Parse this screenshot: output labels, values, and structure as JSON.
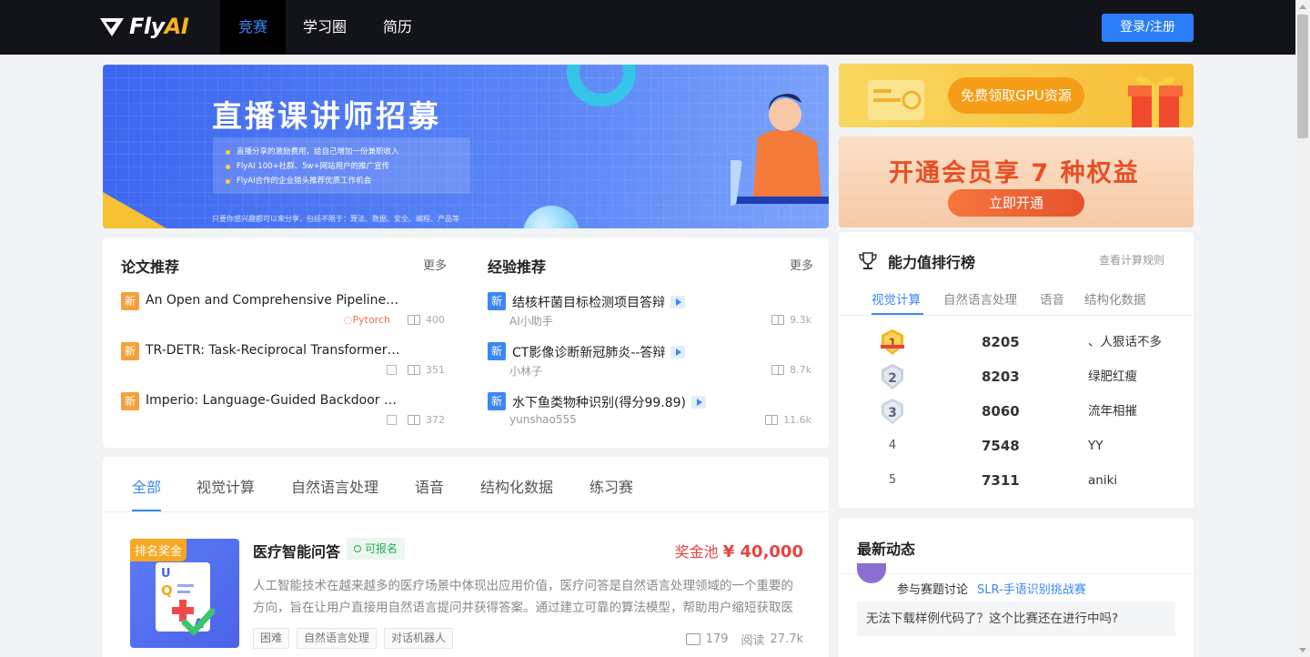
{
  "nav": {
    "logo_fly": "Fly",
    "logo_ai": "AI",
    "items": [
      "竞赛",
      "学习圈",
      "简历"
    ],
    "login": "登录/注册"
  },
  "banner": {
    "title": "直播课讲师招募",
    "points": [
      "直播分享的激励费用，给自己增加一份兼职收入",
      "FlyAI 100+社群、5w+网站用户的推广宣传",
      "FlyAI合作的企业猎头推荐优质工作机会"
    ],
    "footer": "只要你感兴趣都可以来分享，包括不限于：算法、数据、安全、编程、产品等"
  },
  "promo": {
    "gpu": "免费领取GPU资源",
    "vip_title": "开通会员享 7 种权益",
    "vip_button": "立即开通"
  },
  "papers": {
    "title": "论文推荐",
    "more": "更多",
    "badge": "新",
    "items": [
      {
        "text": "An Open and Comprehensive Pipeline for Unified Object Grounding",
        "tag": "Pytorch",
        "count": "400"
      },
      {
        "text": "TR-DETR: Task-Reciprocal Transformer for Joint Moment Retrieval",
        "tag": "",
        "count": "351"
      },
      {
        "text": "Imperio: Language-Guided Backdoor Attacks for Arbitrary Model Control",
        "tag": "",
        "count": "372"
      }
    ]
  },
  "experience": {
    "title": "经验推荐",
    "more": "更多",
    "badge": "新",
    "items": [
      {
        "text": "结核杆菌目标检测项目答辩",
        "author": "AI小助手",
        "count": "9.3k"
      },
      {
        "text": "CT影像诊断新冠肺炎--答辩",
        "author": "小林子",
        "count": "8.7k"
      },
      {
        "text": "水下鱼类物种识别(得分99.89)",
        "author": "yunshao555",
        "count": "11.6k"
      }
    ]
  },
  "competition": {
    "tabs": [
      "全部",
      "视觉计算",
      "自然语言处理",
      "语音",
      "结构化数据",
      "练习赛"
    ],
    "card": {
      "badge": "排名奖金",
      "name": "医疗智能问答",
      "status": "可报名",
      "prize_label": "奖金池",
      "prize_value": "¥ 40,000",
      "desc": "人工智能技术在越来越多的医疗场景中体现出应用价值，医疗问答是自然语言处理领域的一个重要的方向，旨在让用户直接用自然语言提问并获得答案。通过建立可靠的算法模型，帮助用户缩短获取医疗信息的时间。",
      "tags": [
        "困难",
        "自然语言处理",
        "对话机器人"
      ],
      "comments": "179",
      "reads_label": "阅读",
      "reads": "27.7k"
    }
  },
  "ranking": {
    "title": "能力值排行榜",
    "rule": "查看计算规则",
    "tabs": [
      "视觉计算",
      "自然语言处理",
      "语音",
      "结构化数据"
    ],
    "rows": [
      {
        "rank": "1",
        "score": "8205",
        "user": "、人狠话不多"
      },
      {
        "rank": "2",
        "score": "8203",
        "user": "绿肥红瘦"
      },
      {
        "rank": "3",
        "score": "8060",
        "user": "流年相摧"
      },
      {
        "rank": "4",
        "score": "7548",
        "user": "YY"
      },
      {
        "rank": "5",
        "score": "7311",
        "user": "aniki"
      }
    ]
  },
  "news": {
    "title": "最新动态",
    "action": "参与赛题讨论",
    "link": "SLR-手语识别挑战赛",
    "question": "无法下载样例代码了？这个比赛还在进行中吗?"
  }
}
